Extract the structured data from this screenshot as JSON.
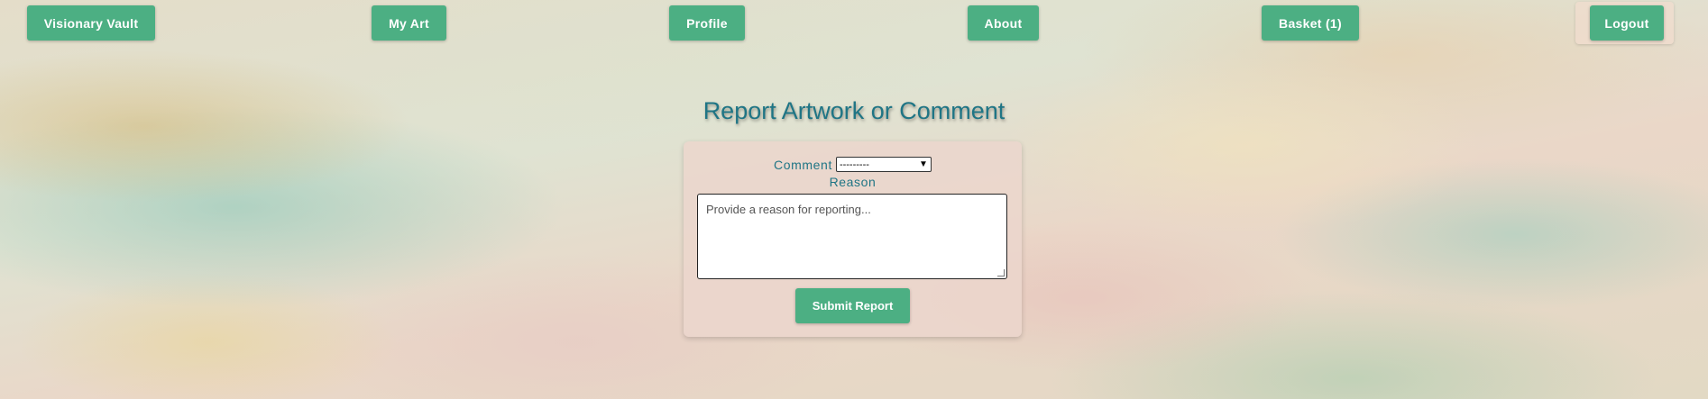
{
  "nav": {
    "brand": "Visionary Vault",
    "my_art": "My Art",
    "profile": "Profile",
    "about": "About",
    "basket": "Basket (1)",
    "logout": "Logout"
  },
  "page_title": "Report Artwork or Comment",
  "form": {
    "comment_label": "Comment",
    "comment_select_value": "---------",
    "reason_label": "Reason",
    "reason_placeholder": "Provide a reason for reporting...",
    "submit_label": "Submit Report"
  },
  "colors": {
    "button": "#4caf83",
    "accent_text": "#1f7585"
  }
}
